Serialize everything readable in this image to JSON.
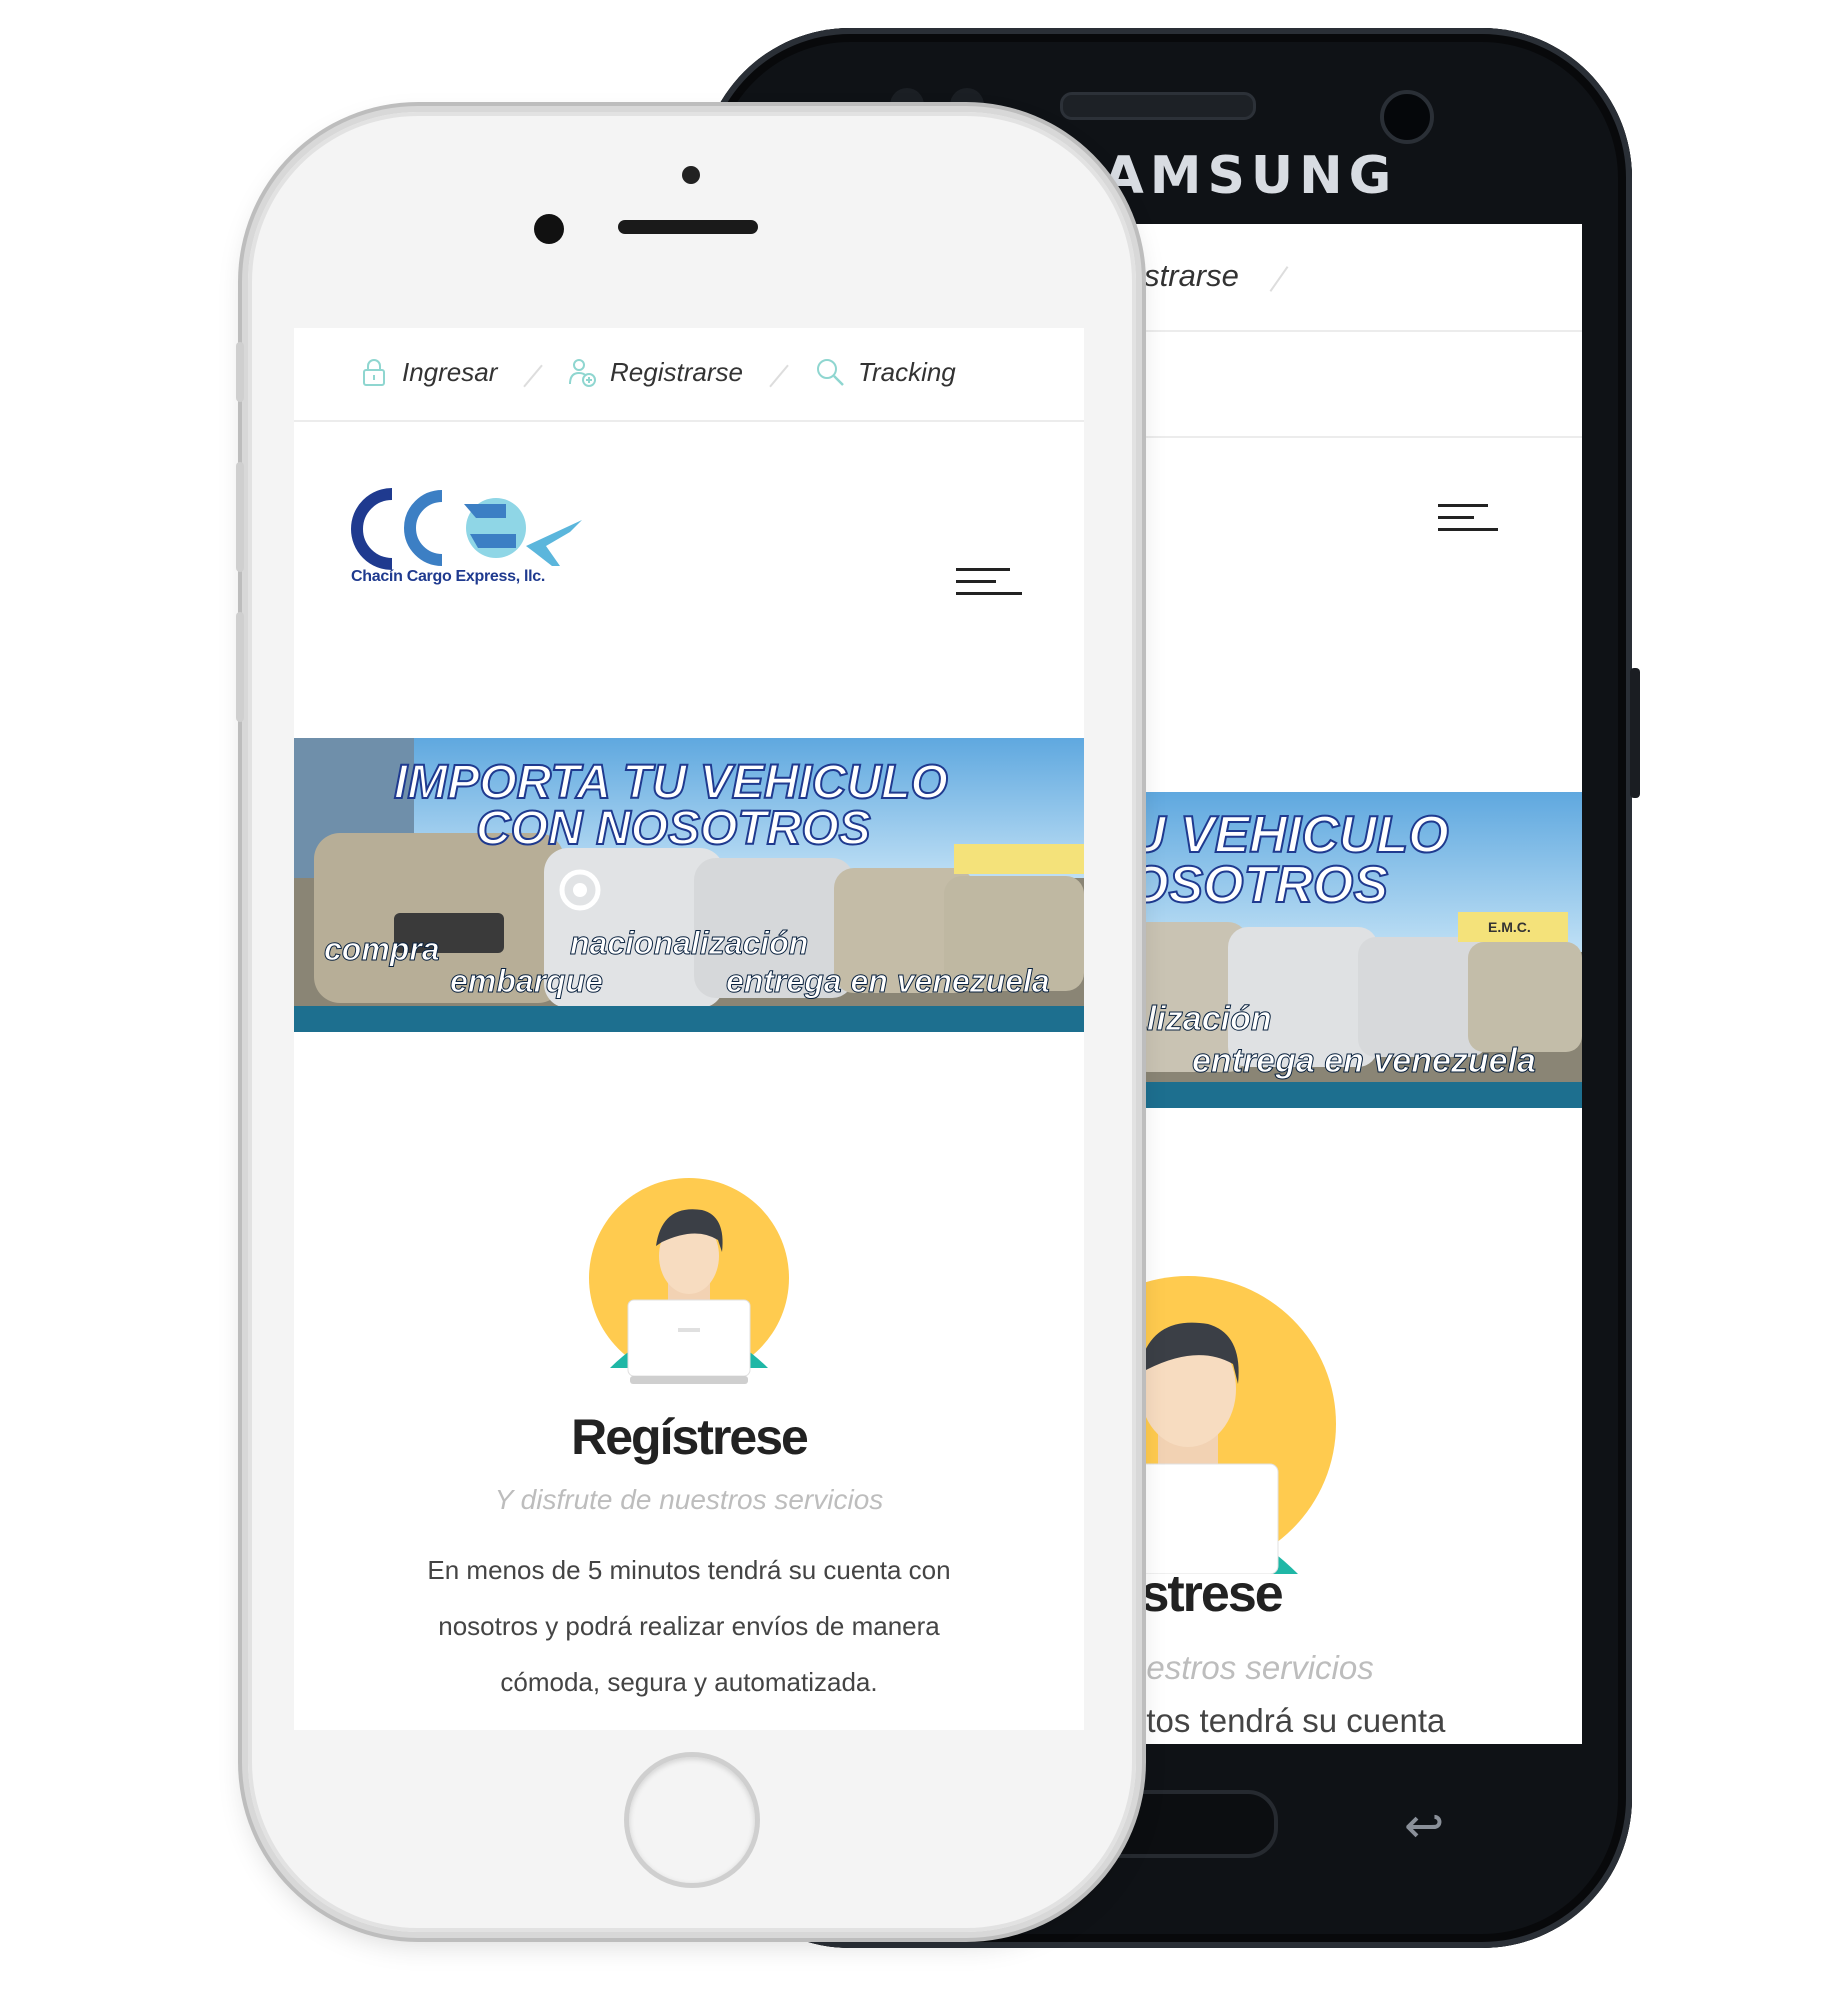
{
  "back_phone": {
    "brand": "SAMSUNG",
    "nav_partial": "gistrarse",
    "banner_line1": "U VEHICULO",
    "banner_line2": "OSOTROS",
    "banner_partial_1": "alización",
    "banner_partial_2": "entrega en venezuela",
    "title_partial": "ístrese",
    "subtitle_partial": "uestros servicios",
    "body_partial": "utos tendrá su cuenta"
  },
  "nav": {
    "login_label": "Ingresar",
    "register_label": "Registrarse",
    "tracking_label": "Tracking"
  },
  "logo": {
    "text": "Chacín Cargo Express, llc."
  },
  "banner": {
    "headline_1": "IMPORTA TU VEHICULO",
    "headline_2": "CON NOSOTROS",
    "bullet_1": "compra",
    "bullet_2": "nacionalización",
    "bullet_3": "embarque",
    "bullet_4": "entrega en venezuela",
    "sign": "E.M.C."
  },
  "register": {
    "title": "Regístrese",
    "subtitle": "Y disfrute de nuestros servicios",
    "body": "En menos de 5 minutos tendrá su cuenta con nosotros y podrá realizar envíos de manera cómoda, segura y automatizada."
  },
  "colors": {
    "accent_blue": "#1f3a8f",
    "avatar_yellow": "#ffcb4f",
    "shirt_teal": "#1fb7a6",
    "banner_text": "#ffffff"
  }
}
